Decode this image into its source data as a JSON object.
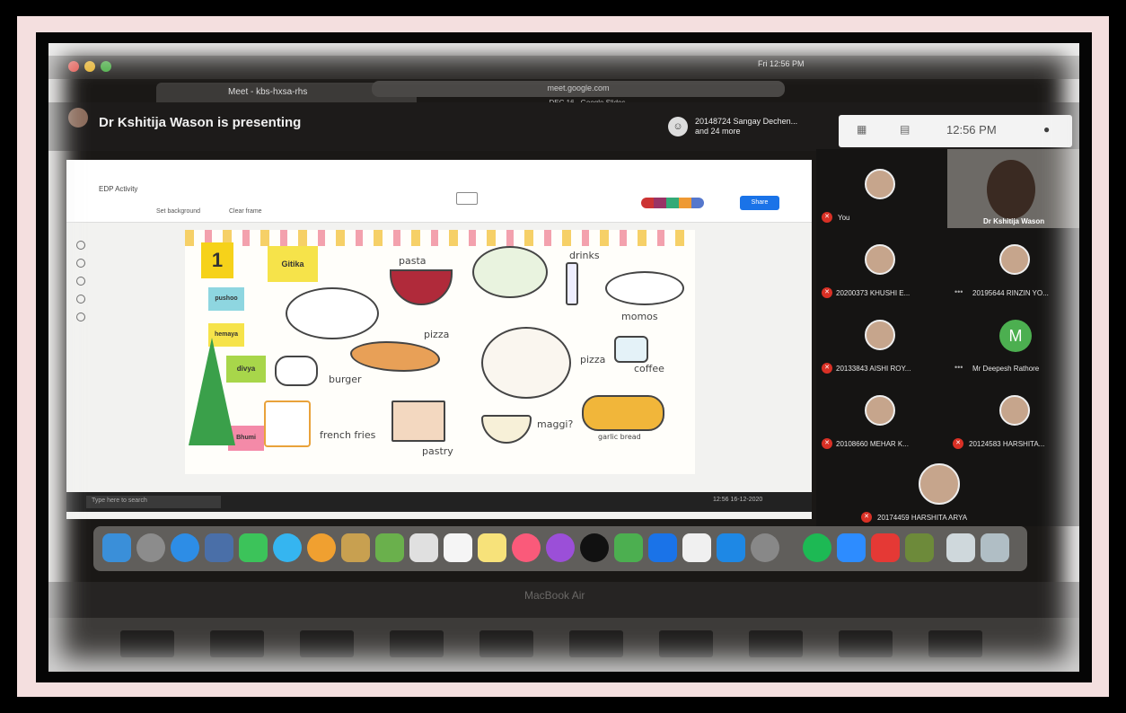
{
  "browser": {
    "tab_title": "Meet - kbs-hxsa-rhs",
    "url": "meet.google.com",
    "slides_tab": "DEC 16 - Google Slides",
    "menu_right": "Fri 12:56 PM"
  },
  "meet": {
    "presenting_title": "Dr Kshitija Wason is presenting",
    "viewers": "20148724 Sangay Dechen...",
    "viewers_more": "and 24 more",
    "clock": "12:56 PM"
  },
  "doc": {
    "title": "EDP Activity",
    "toolbar": [
      "Set background",
      "Clear frame"
    ],
    "share_label": "Share"
  },
  "slide": {
    "number": "1",
    "stickies": [
      {
        "label": "Gitika",
        "color": "#f6e34a"
      },
      {
        "label": "pushoo",
        "color": "#8ed6e0"
      },
      {
        "label": "hemaya",
        "color": "#f6e34a"
      },
      {
        "label": "divya",
        "color": "#a8d64a"
      },
      {
        "label": "Bhumi",
        "color": "#f48aa8"
      }
    ],
    "labels": [
      "pasta",
      "drinks",
      "momos",
      "pizza",
      "pizza",
      "coffee",
      "burger",
      "french fries",
      "pastry",
      "maggi?",
      "garlic bread"
    ]
  },
  "windows": {
    "search_placeholder": "Type here to search",
    "tray": "12:56 16-12-2020"
  },
  "participants": [
    {
      "name": "You"
    },
    {
      "name": "Dr Kshitija Wason"
    },
    {
      "name": "20200373 KHUSHI E..."
    },
    {
      "name": "20195644 RINZIN YO..."
    },
    {
      "name": "20133843 AISHI ROY..."
    },
    {
      "name": "Mr Deepesh Rathore",
      "initial": "M"
    },
    {
      "name": "20108660 MEHAR K..."
    },
    {
      "name": "20124583 HARSHITA..."
    },
    {
      "name": "20174459 HARSHITA ARYA"
    }
  ],
  "laptop": {
    "label": "MacBook Air"
  },
  "colors": {
    "frame_pink": "#f4dfdf",
    "meet_red": "#d93025",
    "share_blue": "#1a73e8"
  }
}
